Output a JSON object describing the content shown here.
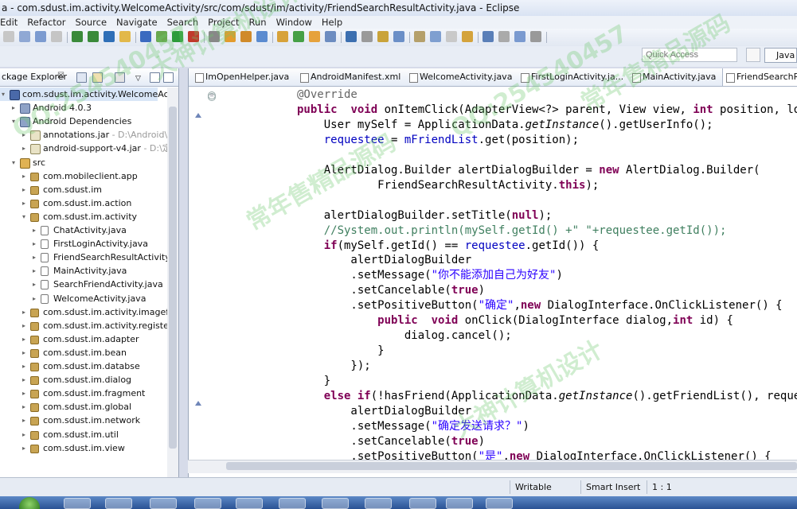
{
  "window": {
    "title": "a - com.sdust.im.activity.WelcomeActivity/src/com/sdust/im/activity/FriendSearchResultActivity.java - Eclipse"
  },
  "menu": [
    "Edit",
    "Refactor",
    "Source",
    "Navigate",
    "Search",
    "Project",
    "Run",
    "Window",
    "Help"
  ],
  "quick_access": {
    "placeholder": "Quick Access"
  },
  "perspective": {
    "label": "Java"
  },
  "package_explorer": {
    "tab_label": "ckage Explorer",
    "tab_close": "☒",
    "tree": [
      {
        "indent": 0,
        "twisty": "▾",
        "icon": "proj",
        "label": "com.sdust.im.activity.WelcomeActivity",
        "detail": ""
      },
      {
        "indent": 1,
        "twisty": "▸",
        "icon": "lib",
        "label": "Android 4.0.3",
        "detail": ""
      },
      {
        "indent": 1,
        "twisty": "▾",
        "icon": "lib",
        "label": "Android Dependencies",
        "detail": ""
      },
      {
        "indent": 2,
        "twisty": "▸",
        "icon": "jar",
        "label": "annotations.jar",
        "detail": " - D:\\Android\\and"
      },
      {
        "indent": 2,
        "twisty": "▸",
        "icon": "jar",
        "label": "android-support-v4.jar",
        "detail": " - D:\\定做\\"
      },
      {
        "indent": 1,
        "twisty": "▾",
        "icon": "src",
        "label": "src",
        "detail": ""
      },
      {
        "indent": 2,
        "twisty": "▸",
        "icon": "pkg",
        "label": "com.mobileclient.app",
        "detail": ""
      },
      {
        "indent": 2,
        "twisty": "▸",
        "icon": "pkg",
        "label": "com.sdust.im",
        "detail": ""
      },
      {
        "indent": 2,
        "twisty": "▸",
        "icon": "pkg",
        "label": "com.sdust.im.action",
        "detail": ""
      },
      {
        "indent": 2,
        "twisty": "▾",
        "icon": "pkg",
        "label": "com.sdust.im.activity",
        "detail": ""
      },
      {
        "indent": 3,
        "twisty": "▸",
        "icon": "java",
        "label": "ChatActivity.java",
        "detail": ""
      },
      {
        "indent": 3,
        "twisty": "▸",
        "icon": "java",
        "label": "FirstLoginActivity.java",
        "detail": ""
      },
      {
        "indent": 3,
        "twisty": "▸",
        "icon": "java",
        "label": "FriendSearchResultActivity.java",
        "detail": ""
      },
      {
        "indent": 3,
        "twisty": "▸",
        "icon": "java",
        "label": "MainActivity.java",
        "detail": ""
      },
      {
        "indent": 3,
        "twisty": "▸",
        "icon": "java",
        "label": "SearchFriendActivity.java",
        "detail": ""
      },
      {
        "indent": 3,
        "twisty": "▸",
        "icon": "java",
        "label": "WelcomeActivity.java",
        "detail": ""
      },
      {
        "indent": 2,
        "twisty": "▸",
        "icon": "pkg",
        "label": "com.sdust.im.activity.imagefactor",
        "detail": ""
      },
      {
        "indent": 2,
        "twisty": "▸",
        "icon": "pkg",
        "label": "com.sdust.im.activity.register",
        "detail": ""
      },
      {
        "indent": 2,
        "twisty": "▸",
        "icon": "pkg",
        "label": "com.sdust.im.adapter",
        "detail": ""
      },
      {
        "indent": 2,
        "twisty": "▸",
        "icon": "pkg",
        "label": "com.sdust.im.bean",
        "detail": ""
      },
      {
        "indent": 2,
        "twisty": "▸",
        "icon": "pkg",
        "label": "com.sdust.im.databse",
        "detail": ""
      },
      {
        "indent": 2,
        "twisty": "▸",
        "icon": "pkg",
        "label": "com.sdust.im.dialog",
        "detail": ""
      },
      {
        "indent": 2,
        "twisty": "▸",
        "icon": "pkg",
        "label": "com.sdust.im.fragment",
        "detail": ""
      },
      {
        "indent": 2,
        "twisty": "▸",
        "icon": "pkg",
        "label": "com.sdust.im.global",
        "detail": ""
      },
      {
        "indent": 2,
        "twisty": "▸",
        "icon": "pkg",
        "label": "com.sdust.im.network",
        "detail": ""
      },
      {
        "indent": 2,
        "twisty": "▸",
        "icon": "pkg",
        "label": "com.sdust.im.util",
        "detail": ""
      },
      {
        "indent": 2,
        "twisty": "▸",
        "icon": "pkg",
        "label": "com.sdust.im.view",
        "detail": ""
      }
    ]
  },
  "editor": {
    "tabs": [
      {
        "label": "ImOpenHelper.java",
        "active": false
      },
      {
        "label": "AndroidManifest.xml",
        "active": false
      },
      {
        "label": "WelcomeActivity.java",
        "active": false
      },
      {
        "label": "FirstLoginActivity.ja...",
        "active": false
      },
      {
        "label": "MainActivity.java",
        "active": false
      },
      {
        "label": "FriendSearchRes",
        "active": true
      }
    ],
    "code_lines": [
      [
        [
          "an",
          "@Override"
        ]
      ],
      [
        [
          "kw",
          "public"
        ],
        [
          "",
          "  "
        ],
        [
          "kw",
          "void"
        ],
        [
          "",
          " onItemClick(AdapterView<?> parent, View view, "
        ],
        [
          "kw",
          "int"
        ],
        [
          "",
          " position, lo"
        ]
      ],
      [
        [
          "",
          "    User mySelf = ApplicationData."
        ],
        [
          "it",
          "getInstance"
        ],
        [
          "",
          "().getUserInfo();"
        ]
      ],
      [
        [
          "fd",
          "    requestee"
        ],
        [
          "",
          " = "
        ],
        [
          "fd",
          "mFriendList"
        ],
        [
          "",
          ".get(position);"
        ]
      ],
      [
        [
          "",
          ""
        ]
      ],
      [
        [
          "",
          "    AlertDialog.Builder alertDialogBuilder = "
        ],
        [
          "kw",
          "new"
        ],
        [
          "",
          " AlertDialog.Builder("
        ]
      ],
      [
        [
          "",
          "            FriendSearchResultActivity."
        ],
        [
          "kw",
          "this"
        ],
        [
          "",
          ");"
        ]
      ],
      [
        [
          "",
          ""
        ]
      ],
      [
        [
          "",
          "    alertDialogBuilder.setTitle("
        ],
        [
          "kw",
          "null"
        ],
        [
          "",
          ");"
        ]
      ],
      [
        [
          "cm",
          "    //System.out.println(mySelf.getId() +\" \"+requestee.getId());"
        ]
      ],
      [
        [
          "kw",
          "    if"
        ],
        [
          "",
          "(mySelf.getId() == "
        ],
        [
          "fd",
          "requestee"
        ],
        [
          "",
          ".getId()) {"
        ]
      ],
      [
        [
          "",
          "        alertDialogBuilder"
        ]
      ],
      [
        [
          "",
          "        .setMessage("
        ],
        [
          "st",
          "\"你不能添加自己为好友\""
        ],
        [
          "",
          ")"
        ]
      ],
      [
        [
          "",
          "        .setCancelable("
        ],
        [
          "kw",
          "true"
        ],
        [
          "",
          ")"
        ]
      ],
      [
        [
          "",
          "        .setPositiveButton("
        ],
        [
          "st",
          "\"确定\""
        ],
        [
          "",
          ","
        ],
        [
          "kw",
          "new"
        ],
        [
          "",
          " DialogInterface.OnClickListener() {"
        ]
      ],
      [
        [
          "kw",
          "            public"
        ],
        [
          "",
          "  "
        ],
        [
          "kw",
          "void"
        ],
        [
          "",
          " onClick(DialogInterface dialog,"
        ],
        [
          "kw",
          "int"
        ],
        [
          "",
          " id) {"
        ]
      ],
      [
        [
          "",
          "                dialog.cancel();"
        ]
      ],
      [
        [
          "",
          "            }"
        ]
      ],
      [
        [
          "",
          "        });"
        ]
      ],
      [
        [
          "",
          "    }"
        ]
      ],
      [
        [
          "kw",
          "    else if"
        ],
        [
          "",
          "(!hasFriend(ApplicationData."
        ],
        [
          "it",
          "getInstance"
        ],
        [
          "",
          "().getFriendList(), reque"
        ]
      ],
      [
        [
          "",
          "        alertDialogBuilder"
        ]
      ],
      [
        [
          "",
          "        .setMessage("
        ],
        [
          "st",
          "\"确定发送请求？\""
        ],
        [
          "",
          ")"
        ]
      ],
      [
        [
          "",
          "        .setCancelable("
        ],
        [
          "kw",
          "true"
        ],
        [
          "",
          ")"
        ]
      ],
      [
        [
          "",
          "        .setPositiveButton("
        ],
        [
          "st",
          "\"是\""
        ],
        [
          "",
          ","
        ],
        [
          "kw",
          "new"
        ],
        [
          "",
          " DialogInterface.OnClickListener() {"
        ]
      ]
    ]
  },
  "status": {
    "mode": "Writable",
    "insert": "Smart Insert",
    "position": "1 : 1"
  },
  "watermarks": [
    "QQ:2545404577",
    "大神计算机设计",
    "常年售精品源码",
    "QQ:254540457",
    "常年售精品源码",
    "大神计算机设计"
  ],
  "colors": {
    "keyword": "#7f0055",
    "string": "#2a00ff",
    "comment": "#3f7f5f",
    "field": "#0000c0",
    "annotation": "#646464"
  }
}
